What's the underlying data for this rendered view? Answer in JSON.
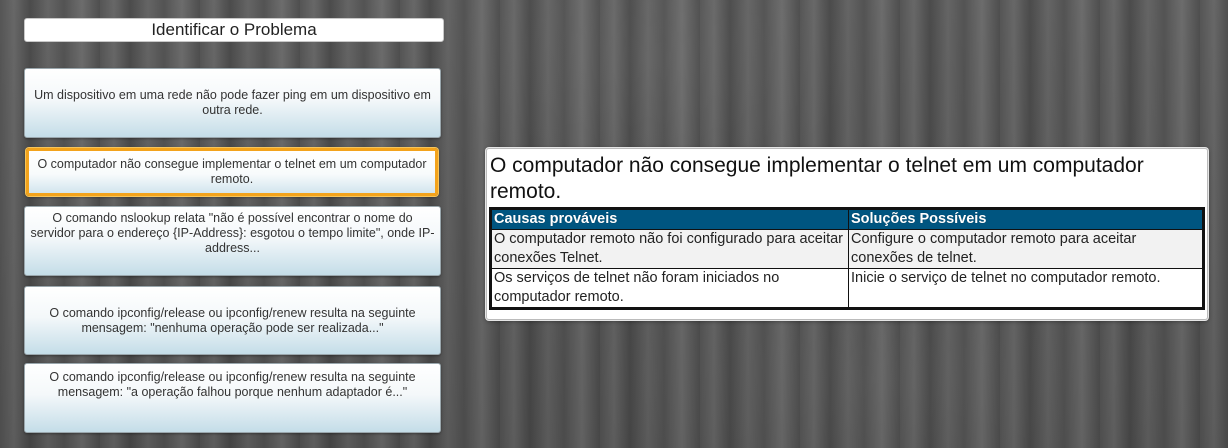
{
  "header": {
    "title": "Identificar o Problema"
  },
  "problems": [
    {
      "text": "Um dispositivo em uma rede não pode fazer ping em um dispositivo em outra rede."
    },
    {
      "text": "O computador não consegue implementar o telnet em um computador remoto."
    },
    {
      "text": "O comando nslookup relata \"não é possível encontrar o nome do servidor para o endereço {IP-Address}: esgotou o tempo limite\", onde IP-address..."
    },
    {
      "text": "O comando ipconfig/release ou ipconfig/renew resulta na seguinte mensagem: \"nenhuma operação pode ser realizada...\""
    },
    {
      "text": "O comando ipconfig/release ou ipconfig/renew resulta na seguinte mensagem: \"a operação falhou porque nenhum adaptador é...\""
    }
  ],
  "selected_index": 1,
  "detail": {
    "title": "O computador não consegue implementar o telnet em um computador remoto.",
    "columns": [
      "Causas prováveis",
      "Soluções Possíveis"
    ],
    "rows": [
      {
        "cause": "O computador remoto não foi configurado para aceitar conexões Telnet.",
        "solution": "Configure o computador remoto para aceitar conexões de telnet."
      },
      {
        "cause": "Os serviços de telnet não foram iniciados no computador remoto.",
        "solution": "Inicie o serviço de telnet no computador remoto."
      }
    ]
  },
  "colors": {
    "selected_border": "#f3a31c",
    "table_header": "#005580"
  }
}
